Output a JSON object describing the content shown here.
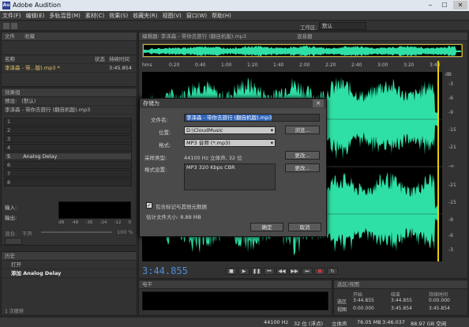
{
  "app": {
    "title": "Adobe Audition"
  },
  "menu": [
    "文件(F)",
    "编辑(E)",
    "多轨混音(M)",
    "素材(C)",
    "效果(S)",
    "收藏夹(R)",
    "视图(V)",
    "窗口(W)",
    "帮助(H)"
  ],
  "workspace": {
    "label": "工作区:",
    "value": "默认"
  },
  "files_panel": {
    "tabs": [
      "文件",
      "收藏"
    ],
    "col_name": "名称",
    "col_status": "状态",
    "col_duration": "持续时间",
    "file_name": "李泽森 - 带你去旅行 (翻自机版).mp3 *",
    "file_name_short": "李泽森 - 带...版).mp3 *",
    "file_duration": "3:45.854"
  },
  "effects_panel": {
    "tab": "效果组",
    "preset_label": "预设:",
    "preset_value": "(默认)",
    "file_label": "李泽森 - 带你去旅行 (翻自机版).mp3",
    "slots": [
      "1",
      "2",
      "3",
      "4",
      "5",
      "6",
      "7",
      "8"
    ],
    "slot5_effect": "Analog Delay",
    "input_label": "输入:",
    "output_label": "输出:",
    "meter_scale": [
      "dB",
      "-48",
      "-36",
      "-24",
      "-12",
      "0"
    ],
    "mix_label": "混合:",
    "mix_dry": "干声",
    "mix_wet": "100 %",
    "apply_label": "应用"
  },
  "history_panel": {
    "tab": "历史",
    "items": [
      "打开",
      "添加 Analog Delay"
    ],
    "undo_count": "1 次撤销"
  },
  "editor": {
    "tab": "编辑器: 李泽森 - 带你去旅行 (翻自机版).mp3",
    "tab2": "混音器",
    "ruler": [
      "hms",
      "0:20",
      "0:40",
      "1:00",
      "1:20",
      "1:40",
      "2:00",
      "2:20",
      "2:40",
      "3:00",
      "3:20",
      "3:40"
    ],
    "db_scale": [
      "dB",
      "-3",
      "-6",
      "-9",
      "-15",
      "-21",
      "-∞",
      "-21",
      "-15",
      "-9",
      "-6",
      "-3"
    ],
    "timecode": "3:44.855"
  },
  "selection_panel": {
    "tab": "选区/视图",
    "cols": [
      "开始",
      "结束",
      "持续时间"
    ],
    "rows": [
      {
        "label": "选区",
        "start": "3:44.855",
        "end": "3:44.855",
        "dur": "0:00.000"
      },
      {
        "label": "视图",
        "start": "0:00.000",
        "end": "3:45.854",
        "dur": "3:45.854"
      }
    ]
  },
  "levels_panel": {
    "tab": "电平"
  },
  "dialog": {
    "title": "存储为",
    "filename_label": "文件名:",
    "filename_value": "李泽森 - 带你去旅行 (翻自机版).mp3",
    "location_label": "位置:",
    "location_value": "D:\\CloudMusic",
    "browse_button": "浏览...",
    "format_label": "格式:",
    "format_value": "MP3 音频 (*.mp3)",
    "sampletype_label": "采样类型:",
    "sampletype_value": "44100 Hz 立体声, 32 位",
    "change_button": "更改...",
    "formatsettings_label": "格式设置:",
    "formatsettings_value": "MP3 320 Kbps CBR",
    "change_button2": "更改...",
    "include_markers": "包含标记与其他元数据",
    "est_size": "估计文件大小: 8.88 MB",
    "ok_button": "确定",
    "cancel_button": "取消"
  },
  "statusbar": {
    "samplerate": "44100 Hz",
    "bitdepth": "32 位 (浮点)",
    "channels": "立体声",
    "size": "76.05 MB",
    "duration": "3:46.037",
    "free": "88.97 GB 空闲"
  },
  "colors": {
    "waveform": "#2fe0a6",
    "waveform_bg": "#000000",
    "playhead": "#e8d000",
    "accent": "#2e63b8"
  }
}
